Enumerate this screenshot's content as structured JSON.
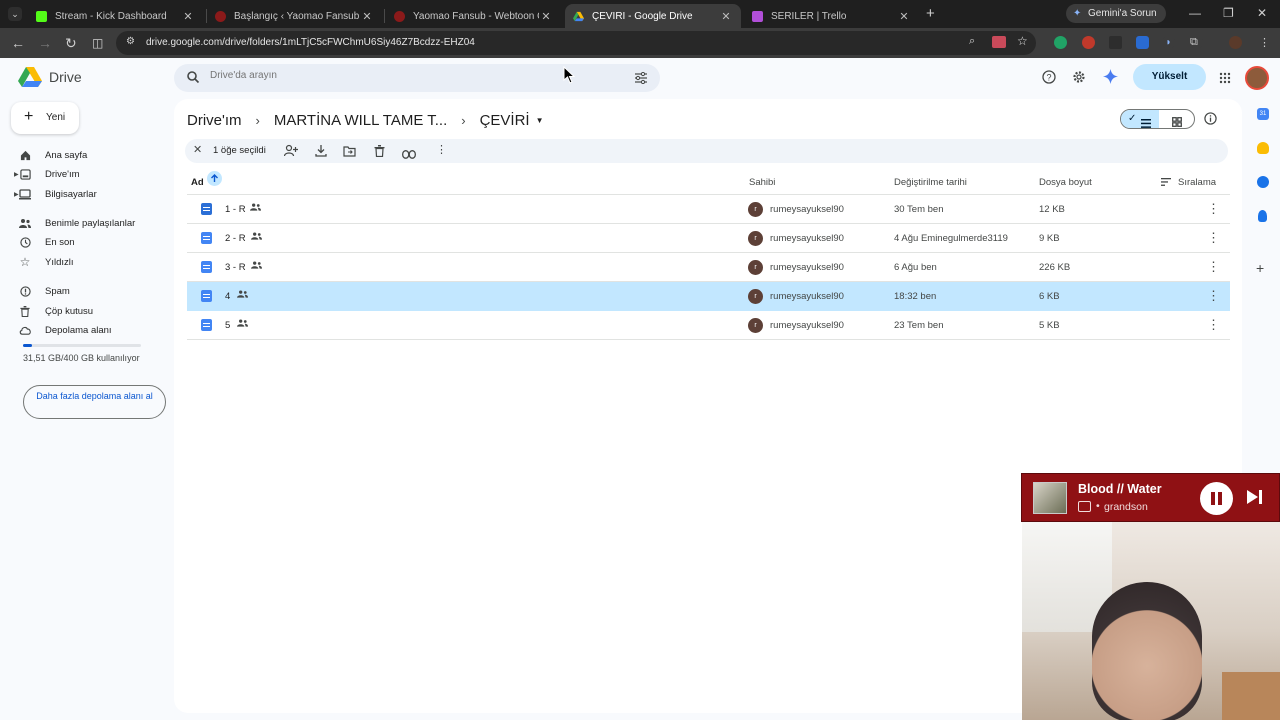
{
  "browser": {
    "tabs": [
      {
        "title": "Stream - Kick Dashboard",
        "favicon_color": "#53fc18",
        "active": false
      },
      {
        "title": "Başlangıç ‹ Yaomao Fansub — W",
        "favicon_color": "#8b1a1a",
        "active": false
      },
      {
        "title": "Yaomao Fansub - Webtoon Oku",
        "favicon_color": "#8b1a1a",
        "active": false
      },
      {
        "title": "ÇEVİRİ - Google Drive",
        "favicon_color": "#34a853",
        "active": true
      },
      {
        "title": "SERİLER | Trello",
        "favicon_color": "#b14fd8",
        "active": false
      }
    ],
    "new_tab_icon": "plus-icon",
    "gemini_button": "Gemini'a Sorun",
    "url": "drive.google.com/drive/folders/1mLTjC5cFWChmU6Siy46Z7Bcdzz-EHZ04"
  },
  "drive": {
    "logo_text": "Drive",
    "search_placeholder": "Drive'da arayın",
    "upgrade_label": "Yükselt",
    "new_button": "Yeni",
    "nav": [
      {
        "label": "Ana sayfa",
        "icon": "home-icon"
      },
      {
        "label": "Drive'ım",
        "icon": "my-drive-icon"
      },
      {
        "label": "Bilgisayarlar",
        "icon": "computer-icon"
      },
      {
        "label": "Benimle paylaşılanlar",
        "icon": "shared-icon"
      },
      {
        "label": "En son",
        "icon": "clock-icon"
      },
      {
        "label": "Yıldızlı",
        "icon": "star-icon"
      },
      {
        "label": "Spam",
        "icon": "spam-icon"
      },
      {
        "label": "Çöp kutusu",
        "icon": "trash-icon"
      },
      {
        "label": "Depolama alanı",
        "icon": "cloud-icon"
      }
    ],
    "storage": {
      "text": "31,51 GB/400 GB kullanılıyor",
      "used_fraction": 0.079
    },
    "more_storage_button": "Daha fazla depolama alanı al",
    "breadcrumb": [
      "Drive'ım",
      "MARTİNA WILL TAME T...",
      "ÇEVİRİ"
    ],
    "selection_text": "1 öğe seçildi",
    "columns": {
      "name": "Ad",
      "owner": "Sahibi",
      "modified": "Değiştirilme tarihi",
      "size": "Dosya boyut",
      "sort": "Sıralama"
    },
    "files": [
      {
        "name": "1 - R",
        "owner": "rumeysayuksel90",
        "owner_initial": "r",
        "modified": "30 Tem ben",
        "size": "12 KB",
        "selected": false,
        "type": "word"
      },
      {
        "name": "2 - R",
        "owner": "rumeysayuksel90",
        "owner_initial": "r",
        "modified": "4 Ağu Eminegulmerde3119",
        "size": "9 KB",
        "selected": false,
        "type": "doc"
      },
      {
        "name": "3 - R",
        "owner": "rumeysayuksel90",
        "owner_initial": "r",
        "modified": "6 Ağu ben",
        "size": "226 KB",
        "selected": false,
        "type": "doc"
      },
      {
        "name": "4",
        "owner": "rumeysayuksel90",
        "owner_initial": "r",
        "modified": "18:32 ben",
        "size": "6 KB",
        "selected": true,
        "type": "doc"
      },
      {
        "name": "5",
        "owner": "rumeysayuksel90",
        "owner_initial": "r",
        "modified": "23 Tem ben",
        "size": "5 KB",
        "selected": false,
        "type": "doc"
      }
    ]
  },
  "music": {
    "song": "Blood // Water",
    "artist": "grandson"
  }
}
